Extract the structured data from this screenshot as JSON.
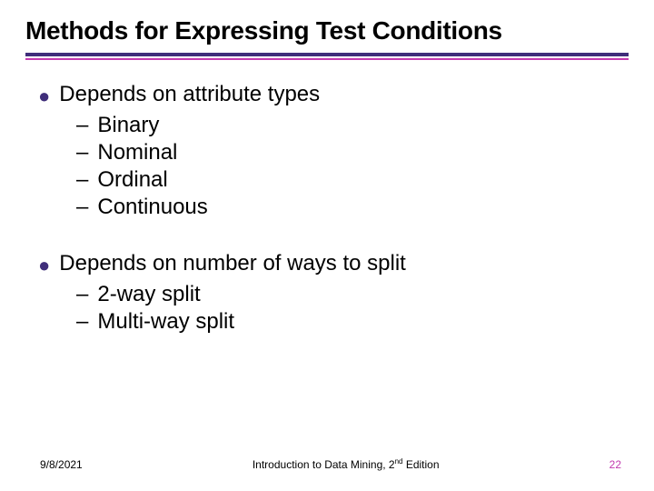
{
  "title": "Methods for Expressing Test Conditions",
  "bullets": [
    {
      "text": "Depends on attribute types",
      "sub": [
        "Binary",
        "Nominal",
        "Ordinal",
        "Continuous"
      ]
    },
    {
      "text": "Depends on number of ways to split",
      "sub": [
        "2-way split",
        "Multi-way split"
      ]
    }
  ],
  "footer": {
    "date": "9/8/2021",
    "center_prefix": "Introduction to Data Mining, 2",
    "center_ord": "nd",
    "center_suffix": " Edition",
    "page": "22"
  }
}
